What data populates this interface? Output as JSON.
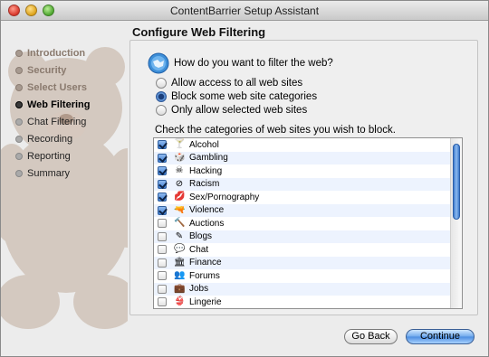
{
  "window": {
    "title": "ContentBarrier Setup Assistant"
  },
  "sidebar": {
    "steps": [
      {
        "label": "Introduction",
        "state": "done"
      },
      {
        "label": "Security",
        "state": "done"
      },
      {
        "label": "Select Users",
        "state": "done"
      },
      {
        "label": "Web Filtering",
        "state": "current"
      },
      {
        "label": "Chat Filtering",
        "state": "todo"
      },
      {
        "label": "Recording",
        "state": "todo"
      },
      {
        "label": "Reporting",
        "state": "todo"
      },
      {
        "label": "Summary",
        "state": "todo"
      }
    ]
  },
  "main": {
    "title": "Configure Web Filtering",
    "question": "How do you want to filter the web?",
    "options": [
      {
        "label": "Allow access to all web sites",
        "selected": false
      },
      {
        "label": "Block some web site categories",
        "selected": true
      },
      {
        "label": "Only allow selected web sites",
        "selected": false
      }
    ],
    "check_label": "Check the categories of web sites you wish to block.",
    "categories": [
      {
        "label": "Alcohol",
        "checked": true,
        "icon": "bottle-icon",
        "glyph": "🍸"
      },
      {
        "label": "Gambling",
        "checked": true,
        "icon": "dice-icon",
        "glyph": "🎲"
      },
      {
        "label": "Hacking",
        "checked": true,
        "icon": "skull-icon",
        "glyph": "☠"
      },
      {
        "label": "Racism",
        "checked": true,
        "icon": "prohibited-icon",
        "glyph": "⊘"
      },
      {
        "label": "Sex/Pornography",
        "checked": true,
        "icon": "kiss-icon",
        "glyph": "💋"
      },
      {
        "label": "Violence",
        "checked": true,
        "icon": "gun-icon",
        "glyph": "🔫"
      },
      {
        "label": "Auctions",
        "checked": false,
        "icon": "gavel-icon",
        "glyph": "🔨"
      },
      {
        "label": "Blogs",
        "checked": false,
        "icon": "pen-icon",
        "glyph": "✎"
      },
      {
        "label": "Chat",
        "checked": false,
        "icon": "chat-bubble-icon",
        "glyph": "💬"
      },
      {
        "label": "Finance",
        "checked": false,
        "icon": "bank-icon",
        "glyph": "🏛"
      },
      {
        "label": "Forums",
        "checked": false,
        "icon": "people-icon",
        "glyph": "👥"
      },
      {
        "label": "Jobs",
        "checked": false,
        "icon": "briefcase-icon",
        "glyph": "💼"
      },
      {
        "label": "Lingerie",
        "checked": false,
        "icon": "lingerie-icon",
        "glyph": "👙"
      }
    ]
  },
  "footer": {
    "back_label": "Go Back",
    "continue_label": "Continue"
  }
}
